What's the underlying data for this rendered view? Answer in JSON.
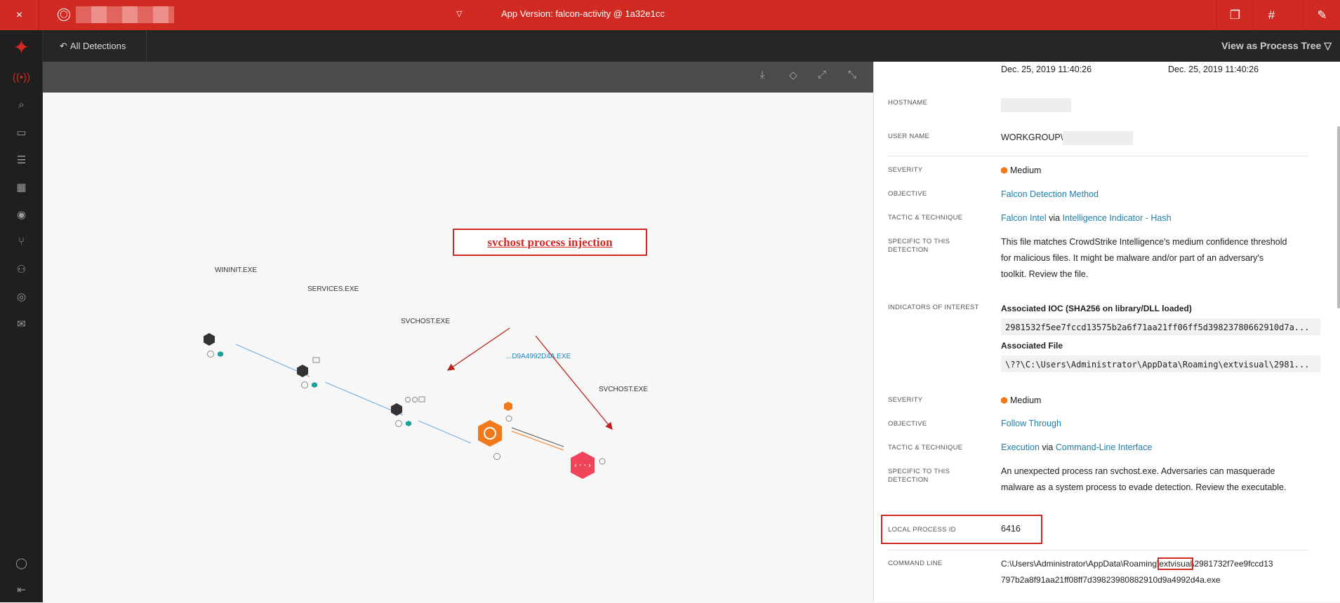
{
  "topbar": {
    "close_icon": "×",
    "caret": "▽",
    "version": "App Version: falcon-activity @ 1a32e1cc"
  },
  "subheader": {
    "back_label": "All Detections",
    "view_label": "View as Process Tree ▽"
  },
  "annotation": {
    "text": "svchost process injection"
  },
  "graph": {
    "nodes": [
      {
        "label": "WININIT.EXE",
        "color": "#333333"
      },
      {
        "label": "SERVICES.EXE",
        "color": "#333333"
      },
      {
        "label": "SVCHOST.EXE",
        "color": "#333333"
      },
      {
        "label": "...D9A4992D4A.EXE",
        "color": "#f07a1b"
      },
      {
        "label": "SVCHOST.EXE",
        "color": "#f0445a"
      }
    ]
  },
  "panel": {
    "times": [
      "Dec. 25, 2019 11:40:26",
      "Dec. 25, 2019 11:40:26"
    ],
    "hostname_label": "HOSTNAME",
    "username_label": "USER NAME",
    "username_value": "WORKGROUP\\",
    "det1": {
      "severity_label": "SEVERITY",
      "severity": "Medium",
      "objective_label": "OBJECTIVE",
      "objective": "Falcon Detection Method",
      "tactic_label": "TACTIC & TECHNIQUE",
      "tactic": "Falcon Intel",
      "via": "via",
      "technique": "Intelligence Indicator - Hash",
      "specific_label": "SPECIFIC TO THIS DETECTION",
      "specific_1": "This file matches CrowdStrike Intelligence's medium confidence threshold",
      "specific_2": "for malicious files. It might be malware and/or part of an adversary's",
      "specific_3": "toolkit. Review the file.",
      "ioi_label": "INDICATORS OF INTEREST",
      "ioc_title": "Associated IOC (SHA256 on library/DLL loaded)",
      "ioc_value": "2981532f5ee7fccd13575b2a6f71aa21ff06ff5d39823780662910d7a...",
      "file_title": "Associated File",
      "file_value": "\\??\\C:\\Users\\Administrator\\AppData\\Roaming\\extvisual\\2981..."
    },
    "det2": {
      "severity_label": "SEVERITY",
      "severity": "Medium",
      "objective_label": "OBJECTIVE",
      "objective": "Follow Through",
      "tactic_label": "TACTIC & TECHNIQUE",
      "tactic": "Execution",
      "via": "via",
      "technique": "Command-Line Interface",
      "specific_label": "SPECIFIC TO THIS DETECTION",
      "specific_1": "An unexpected process ran svchost.exe. Adversaries can masquerade",
      "specific_2": "malware as a system process to evade detection. Review the executable."
    },
    "pid_label": "LOCAL PROCESS ID",
    "pid_value": "6416",
    "cmd_label": "COMMAND LINE",
    "cmd_1a": "C:\\Users\\Administrator\\AppData\\Roaming\\",
    "cmd_1b": "extvisual",
    "cmd_1c": "\\2981732f7ee9fccd13",
    "cmd_2": "797b2a8f91aa21ff08ff7d39823980882910d9a4992d4a.exe"
  }
}
